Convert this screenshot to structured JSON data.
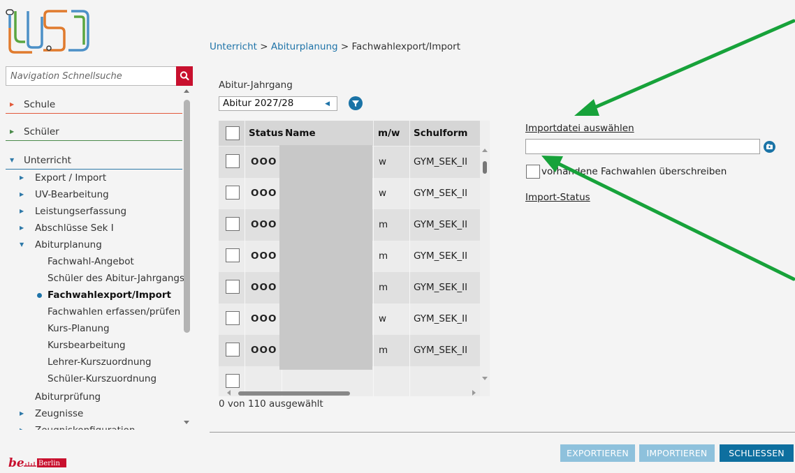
{
  "search": {
    "placeholder": "Navigation Schnellsuche"
  },
  "logo_bottom": {
    "text": "be Berlin"
  },
  "nav": {
    "schule": "Schule",
    "schueler": "Schüler",
    "unterricht": "Unterricht",
    "items": [
      {
        "label": "Export / Import"
      },
      {
        "label": "UV-Bearbeitung"
      },
      {
        "label": "Leistungserfassung"
      },
      {
        "label": "Abschlüsse Sek I"
      },
      {
        "label": "Abiturplanung"
      }
    ],
    "sub_items": [
      {
        "label": "Fachwahl-Angebot"
      },
      {
        "label": "Schüler des Abitur-Jahrgangs"
      },
      {
        "label": "Fachwahlexport/Import"
      },
      {
        "label": "Fachwahlen erfassen/prüfen"
      },
      {
        "label": "Kurs-Planung"
      },
      {
        "label": "Kursbearbeitung"
      },
      {
        "label": "Lehrer-Kurszuordnung"
      },
      {
        "label": "Schüler-Kurszuordnung"
      }
    ],
    "abiturpruefung": "Abiturprüfung",
    "zeugnisse": "Zeugnisse",
    "zeugniskonfiguration": "Zeugniskonfiguration"
  },
  "breadcrumb": {
    "part1": "Unterricht",
    "sep1": " > ",
    "part2": "Abiturplanung",
    "sep2": " > ",
    "current": "Fachwahlexport/Import"
  },
  "jahrgang": {
    "label": "Abitur-Jahrgang",
    "value": "Abitur 2027/28"
  },
  "table": {
    "headers": {
      "status": "Status",
      "name": "Name",
      "mw": "m/w",
      "schulform": "Schulform"
    },
    "rows": [
      {
        "status": "OOO",
        "mw": "w",
        "schulform": "GYM_SEK_II"
      },
      {
        "status": "OOO",
        "mw": "w",
        "schulform": "GYM_SEK_II"
      },
      {
        "status": "OOO",
        "mw": "m",
        "schulform": "GYM_SEK_II"
      },
      {
        "status": "OOO",
        "mw": "m",
        "schulform": "GYM_SEK_II"
      },
      {
        "status": "OOO",
        "mw": "m",
        "schulform": "GYM_SEK_II"
      },
      {
        "status": "OOO",
        "mw": "w",
        "schulform": "GYM_SEK_II"
      },
      {
        "status": "OOO",
        "mw": "m",
        "schulform": "GYM_SEK_II"
      }
    ]
  },
  "selection": {
    "count": "0 von 110 ausgewählt"
  },
  "import": {
    "select_file": "Importdatei auswählen",
    "overwrite": "vorhandene Fachwahlen überschreiben",
    "status": "Import-Status"
  },
  "buttons": {
    "export": "EXPORTIEREN",
    "import": "IMPORTIEREN",
    "close": "SCHLIESSEN"
  },
  "colors": {
    "accent_blue": "#1a73a6",
    "button_primary": "#0e6f9f",
    "button_disabled": "#8ec1dc",
    "search_red": "#c8102e",
    "annotation_green": "#17a23a"
  }
}
